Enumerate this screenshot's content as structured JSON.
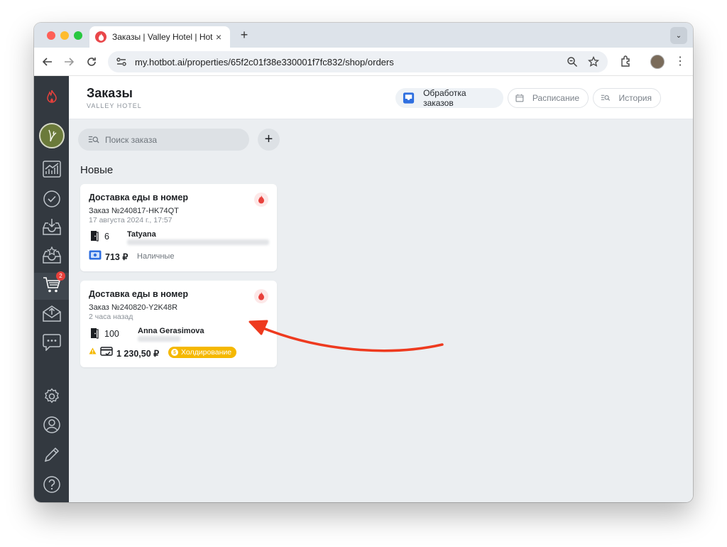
{
  "browser": {
    "tab_title": "Заказы | Valley Hotel | Hotbot",
    "url": "my.hotbot.ai/properties/65f2c01f38e330001f7fc832/shop/orders"
  },
  "header": {
    "title": "Заказы",
    "subtitle": "VALLEY HOTEL",
    "buttons": {
      "process": "Обработка заказов",
      "schedule": "Расписание",
      "history": "История"
    }
  },
  "sidebar": {
    "cart_badge": "2"
  },
  "search": {
    "placeholder": "Поиск заказа"
  },
  "section_title": "Новые",
  "orders": [
    {
      "title": "Доставка еды в номер",
      "number": "Заказ №240817-HK74QT",
      "time": "17 августа 2024 г., 17:57",
      "room": "6",
      "guest": "Tatyana",
      "price": "713 ₽",
      "payment": "Наличные"
    },
    {
      "title": "Доставка еды в номер",
      "number": "Заказ №240820-Y2K48R",
      "time": "2 часа назад",
      "room": "100",
      "guest": "Anna Gerasimova",
      "price": "1 230,50 ₽",
      "status": "Холдирование"
    }
  ],
  "colors": {
    "sidebar": "#333940",
    "accent_red": "#e8413c",
    "hold_yellow": "#f5b800",
    "content_bg": "#ebeef1",
    "arrow": "#ee3a1f"
  }
}
